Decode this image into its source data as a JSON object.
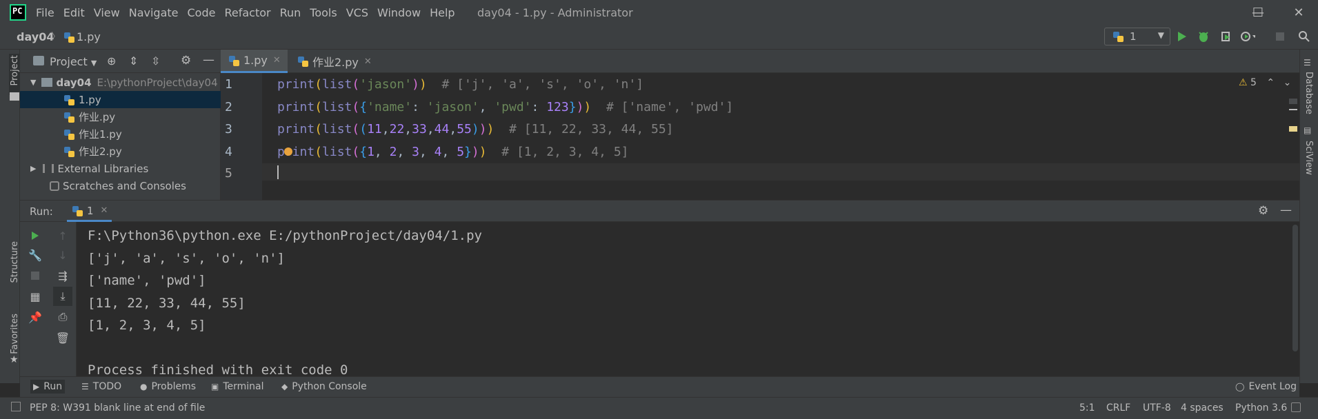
{
  "app": {
    "logo_text": "PC",
    "window_title": "day04 - 1.py - Administrator"
  },
  "menu": [
    "File",
    "Edit",
    "View",
    "Navigate",
    "Code",
    "Refactor",
    "Run",
    "Tools",
    "VCS",
    "Window",
    "Help"
  ],
  "window_controls": {
    "minimize": "—",
    "maximize": "☐",
    "close": "✕"
  },
  "navbar": {
    "project": "day04",
    "separator": "〉",
    "file": "1.py",
    "run_config": "1",
    "run_config_chevron": "▼"
  },
  "toolbar_icons": [
    "run-icon",
    "debug-icon",
    "coverage-icon",
    "profile-icon",
    "stop-icon",
    "search-icon"
  ],
  "left_strip": {
    "project": "Project",
    "structure": "Structure",
    "favorites": "Favorites"
  },
  "right_strip": {
    "database": "Database",
    "sciview": "SciView"
  },
  "project_panel": {
    "title": "Project",
    "chevron": "▼",
    "root": {
      "name": "day04",
      "path": "E:\\pythonProject\\day04"
    },
    "files": [
      "1.py",
      "作业.py",
      "作业1.py",
      "作业2.py"
    ],
    "external": "External Libraries",
    "scratches": "Scratches and Consoles"
  },
  "editor": {
    "tabs": [
      {
        "label": "1.py",
        "active": true
      },
      {
        "label": "作业2.py",
        "active": false
      }
    ],
    "line_numbers": [
      "1",
      "2",
      "3",
      "4",
      "5"
    ],
    "inspections": "5",
    "warning_glyph": "⚠"
  },
  "run_panel": {
    "label": "Run:",
    "tab": "1",
    "console": [
      "F:\\Python36\\python.exe E:/pythonProject/day04/1.py",
      "['j', 'a', 's', 'o', 'n']",
      "['name', 'pwd']",
      "[11, 22, 33, 44, 55]",
      "[1, 2, 3, 4, 5]",
      "",
      "Process finished with exit code 0"
    ]
  },
  "bottom_tools": [
    {
      "label": "Run",
      "icon": "▶"
    },
    {
      "label": "TODO",
      "icon": "☰"
    },
    {
      "label": "Problems",
      "icon": "●"
    },
    {
      "label": "Terminal",
      "icon": "▣"
    },
    {
      "label": "Python Console",
      "icon": "◆"
    }
  ],
  "event_log": "Event Log",
  "status": {
    "message": "PEP 8: W391 blank line at end of file",
    "position": "5:1",
    "line_sep": "CRLF",
    "encoding": "UTF-8",
    "indent": "4 spaces",
    "interpreter": "Python 3.6"
  },
  "colors": {
    "background": "#2b2b2b",
    "panel": "#3c3f41",
    "selection": "#0d293e",
    "run_green": "#4caf50",
    "keyword": "#8888c6",
    "string": "#6a8759",
    "number": "#6897bb",
    "comment": "#808080"
  }
}
